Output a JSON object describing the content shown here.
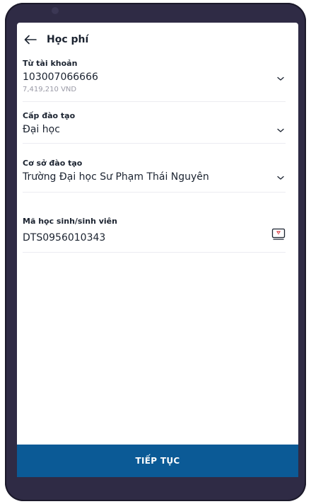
{
  "header": {
    "title": "Học phí"
  },
  "form": {
    "account": {
      "label": "Từ tài khoản",
      "value": "103007066666",
      "balance": "7,419,210 VND"
    },
    "level": {
      "label": "Cấp đào tạo",
      "value": "Đại học"
    },
    "institution": {
      "label": "Cơ sở đào tạo",
      "value": "Trường Đại học Sư Phạm Thái Nguyên"
    },
    "student_id": {
      "label": "Mã học sinh/sinh viên",
      "value": "DTS0956010343"
    }
  },
  "footer": {
    "continue_label": "TIẾP TỤC"
  },
  "colors": {
    "primary": "#0b5a96",
    "text": "#1b2330",
    "muted": "#9a9aa6",
    "alert": "#d9363e"
  },
  "icons": {
    "back": "arrow-left-icon",
    "dropdown": "chevron-down-icon",
    "id_card": "id-card-icon"
  }
}
